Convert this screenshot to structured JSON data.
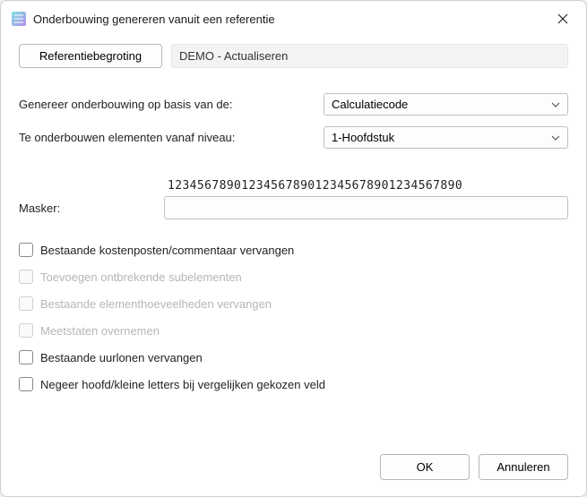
{
  "window": {
    "title": "Onderbouwing genereren vanuit een referentie"
  },
  "reference": {
    "button_label": "Referentiebegroting",
    "value": "DEMO - Actualiseren"
  },
  "fields": {
    "basis_label": "Genereer onderbouwing op basis van de:",
    "basis_value": "Calculatiecode",
    "level_label": "Te onderbouwen elementen vanaf niveau:",
    "level_value": "1-Hoofdstuk",
    "masker_label": "Masker:",
    "ruler": "1234567890123456789012345678901234567890",
    "masker_value": ""
  },
  "checkboxes": {
    "replace_costs": {
      "label": "Bestaande kostenposten/commentaar vervangen",
      "enabled": true
    },
    "add_subelements": {
      "label": "Toevoegen ontbrekende subelementen",
      "enabled": false
    },
    "replace_quantities": {
      "label": "Bestaande elementhoeveelheden vervangen",
      "enabled": false
    },
    "take_measurements": {
      "label": "Meetstaten overnemen",
      "enabled": false
    },
    "replace_wages": {
      "label": "Bestaande uurlonen vervangen",
      "enabled": true
    },
    "ignore_case": {
      "label": "Negeer hoofd/kleine letters bij vergelijken gekozen veld",
      "enabled": true
    }
  },
  "buttons": {
    "ok": "OK",
    "cancel": "Annuleren"
  }
}
